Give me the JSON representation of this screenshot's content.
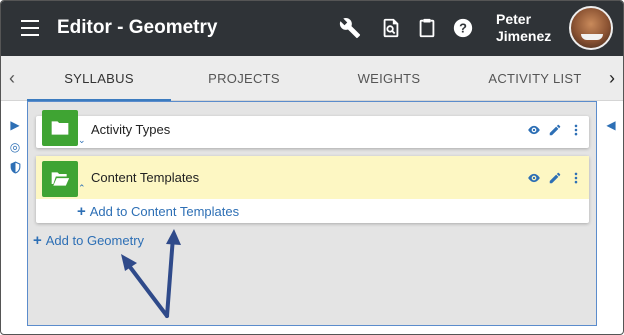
{
  "header": {
    "title": "Editor - Geometry",
    "user_first": "Peter",
    "user_last": "Jimenez",
    "icons": [
      "menu-icon",
      "wrench-icon",
      "preview-icon",
      "clipboard-icon",
      "help-icon"
    ]
  },
  "tabs": {
    "items": [
      {
        "label": "SYLLABUS",
        "active": true
      },
      {
        "label": "PROJECTS",
        "active": false
      },
      {
        "label": "WEIGHTS",
        "active": false
      },
      {
        "label": "ACTIVITY LIST",
        "active": false
      }
    ]
  },
  "items": [
    {
      "title": "Activity Types",
      "expanded": false
    },
    {
      "title": "Content Templates",
      "expanded": true,
      "highlight": "#fdf7c3",
      "add_label": "Add to Content Templates"
    }
  ],
  "add_geometry_label": "Add to Geometry",
  "colors": {
    "topbar": "#2f3337",
    "accent": "#2d6fb5",
    "folder": "#3fa433",
    "annotation_arrow": "#2f4a8a"
  }
}
